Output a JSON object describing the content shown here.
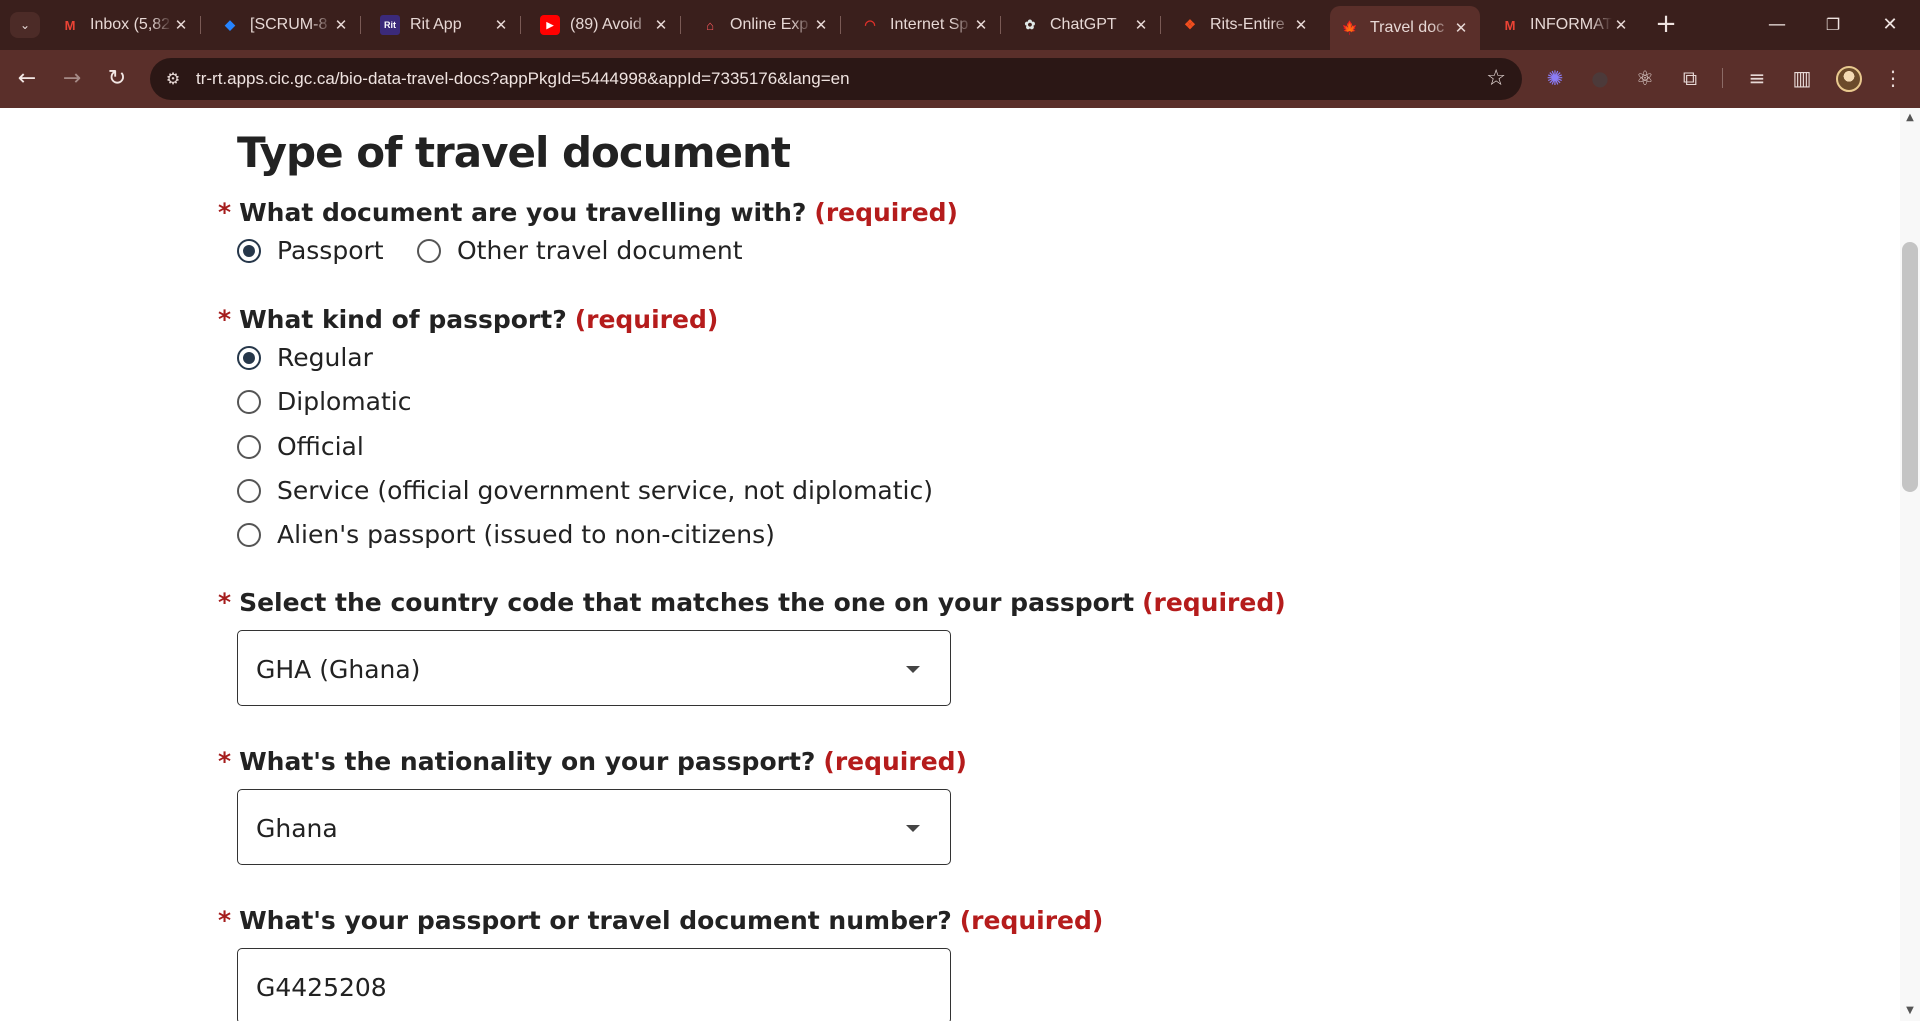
{
  "browser": {
    "tabs": [
      {
        "title": "Inbox (5,82",
        "favicon": "M",
        "favicon_color": "#ea4335"
      },
      {
        "title": "[SCRUM-8",
        "favicon": "◆",
        "favicon_color": "#2684ff"
      },
      {
        "title": "Rit App",
        "favicon": "Rit",
        "favicon_color": "#ffffff"
      },
      {
        "title": "(89) Avoid",
        "favicon": "▶",
        "favicon_color": "#ff0000"
      },
      {
        "title": "Online Exp",
        "favicon": "⌂",
        "favicon_color": "#ff5a5f"
      },
      {
        "title": "Internet Sp",
        "favicon": "◠",
        "favicon_color": "#e0302a"
      },
      {
        "title": "ChatGPT",
        "favicon": "✿",
        "favicon_color": "#dfe7e6"
      },
      {
        "title": "Rits-Entire",
        "favicon": "❖",
        "favicon_color": "#f24e1e"
      },
      {
        "title": "Travel doc",
        "favicon": "🍁",
        "favicon_color": "#d52b1e"
      },
      {
        "title": "INFORMAT",
        "favicon": "M",
        "favicon_color": "#ea4335"
      }
    ],
    "active_tab_index": 8,
    "url": "tr-rt.apps.cic.gc.ca/bio-data-travel-docs?appPkgId=5444998&appId=7335176&lang=en"
  },
  "form": {
    "section_title": "Type of travel document",
    "required_marker": "*",
    "required_text": "(required)",
    "q_document": {
      "label": "What document are you travelling with?",
      "options": [
        "Passport",
        "Other travel document"
      ],
      "selected": "Passport"
    },
    "q_passport_kind": {
      "label": "What kind of passport?",
      "options": [
        "Regular",
        "Diplomatic",
        "Official",
        "Service (official government service, not diplomatic)",
        "Alien's passport (issued to non-citizens)"
      ],
      "selected": "Regular"
    },
    "q_country_code": {
      "label": "Select the country code that matches the one on your passport",
      "value": "GHA (Ghana)"
    },
    "q_nationality": {
      "label": "What's the nationality on your passport?",
      "value": "Ghana"
    },
    "q_doc_number": {
      "label": "What's your passport or travel document number?",
      "value": "G4425208"
    }
  }
}
